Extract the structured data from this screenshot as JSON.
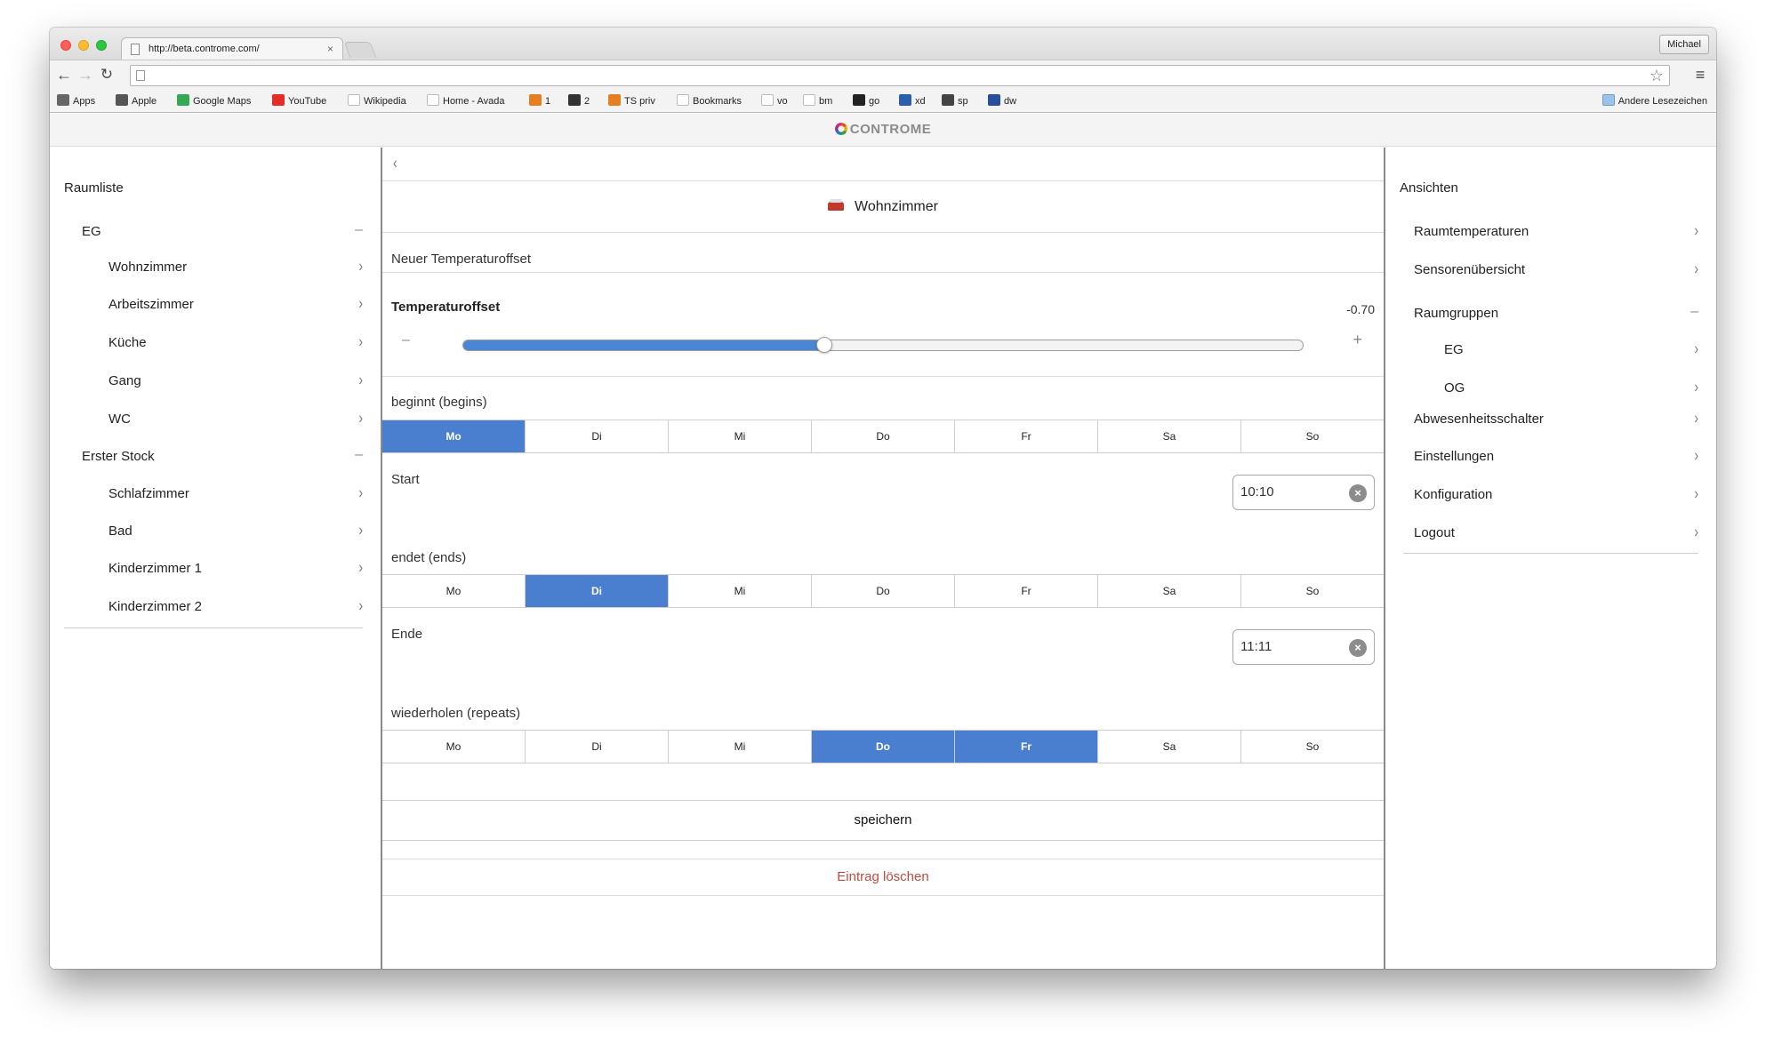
{
  "browser": {
    "tab_title": "http://beta.controme.com/",
    "tab_close": "×",
    "profile_name": "Michael",
    "address": "",
    "bookmarks": [
      {
        "label": "Apps",
        "icon": "apps-grid-icon",
        "color": "#666666"
      },
      {
        "label": "Apple",
        "icon": "apple-icon",
        "color": "#555555"
      },
      {
        "label": "Google Maps",
        "icon": "maps-icon",
        "color": "#34a853"
      },
      {
        "label": "YouTube",
        "icon": "youtube-icon",
        "color": "#e52d27"
      },
      {
        "label": "Wikipedia",
        "icon": "wikipedia-icon",
        "color": "#ffffff"
      },
      {
        "label": "Home - Avada",
        "icon": "google-icon",
        "color": "#ffffff"
      },
      {
        "label": "1",
        "icon": "house-icon",
        "color": "#e67e22"
      },
      {
        "label": "2",
        "icon": "building-icon",
        "color": "#333333"
      },
      {
        "label": "TS priv",
        "icon": "house-icon",
        "color": "#e67e22"
      },
      {
        "label": "Bookmarks",
        "icon": "star-icon",
        "color": "#ffffff"
      },
      {
        "label": "vo",
        "icon": "google-icon",
        "color": "#ffffff"
      },
      {
        "label": "bm",
        "icon": "google-icon",
        "color": "#ffffff"
      },
      {
        "label": "go",
        "icon": "g-black-icon",
        "color": "#222222"
      },
      {
        "label": "xd",
        "icon": "flag-icon",
        "color": "#2b5fad"
      },
      {
        "label": "sp",
        "icon": "sp-icon",
        "color": "#444444"
      },
      {
        "label": "dw",
        "icon": "dwn-icon",
        "color": "#2a4d9c"
      }
    ],
    "other_bookmarks": "Andere Lesezeichen"
  },
  "site": {
    "logo_text": "CONTROME"
  },
  "left_panel": {
    "title": "Raumliste",
    "groups": [
      {
        "label": "EG",
        "rooms": [
          "Wohnzimmer",
          "Arbeitszimmer",
          "Küche",
          "Gang",
          "WC"
        ]
      },
      {
        "label": "Erster Stock",
        "rooms": [
          "Schlafzimmer",
          "Bad",
          "Kinderzimmer 1",
          "Kinderzimmer 2"
        ]
      }
    ]
  },
  "center": {
    "back": "‹",
    "room_name": "Wohnzimmer",
    "section_title": "Neuer Temperaturoffset",
    "offset_label": "Temperaturoffset",
    "offset_value": "-0.70",
    "slider_fraction": 0.43,
    "slider_minus": "–",
    "slider_plus": "+",
    "begins_label": "beginnt (begins)",
    "start_label": "Start",
    "start_time": "10:10",
    "ends_label": "endet (ends)",
    "end_label": "Ende",
    "end_time": "11:11",
    "repeats_label": "wiederholen (repeats)",
    "days": [
      "Mo",
      "Di",
      "Mi",
      "Do",
      "Fr",
      "Sa",
      "So"
    ],
    "begins_selected": [
      "Mo"
    ],
    "ends_selected": [
      "Di"
    ],
    "repeats_selected": [
      "Do",
      "Fr"
    ],
    "save_label": "speichern",
    "delete_label": "Eintrag löschen",
    "accent_color": "#4a7fd0",
    "delete_color": "#c04a3f"
  },
  "right_panel": {
    "title": "Ansichten",
    "items": [
      {
        "label": "Raumtemperaturen",
        "kind": "link"
      },
      {
        "label": "Sensorenübersicht",
        "kind": "link"
      },
      {
        "label": "Raumgruppen",
        "kind": "group"
      },
      {
        "label": "EG",
        "kind": "sub"
      },
      {
        "label": "OG",
        "kind": "sub"
      },
      {
        "label": "Abwesenheitsschalter",
        "kind": "link"
      },
      {
        "label": "Einstellungen",
        "kind": "link"
      },
      {
        "label": "Konfiguration",
        "kind": "link"
      },
      {
        "label": "Logout",
        "kind": "link"
      }
    ]
  }
}
